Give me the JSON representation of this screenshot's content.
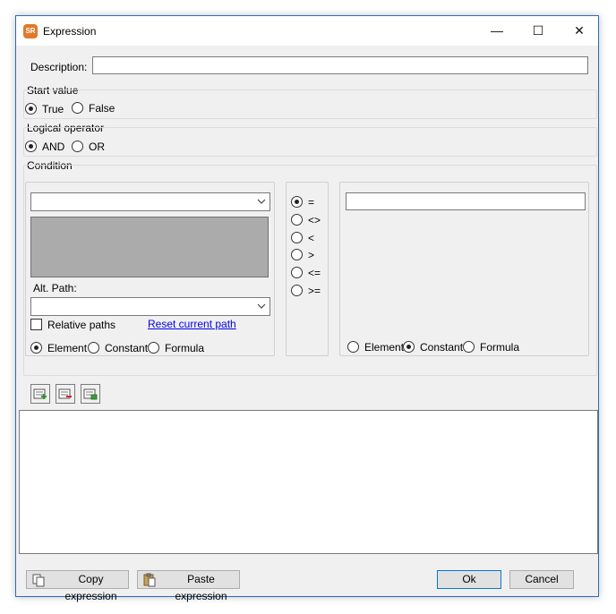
{
  "window": {
    "title": "Expression",
    "icon_text": "SR"
  },
  "titlebar_buttons": {
    "minimize": "—",
    "maximize": "☐",
    "close": "✕"
  },
  "description": {
    "label": "Description:",
    "value": ""
  },
  "start_value": {
    "title": "Start value",
    "options": [
      "True",
      "False"
    ],
    "selected": "True"
  },
  "logical_operator": {
    "title": "Logical operator",
    "options": [
      "AND",
      "OR"
    ],
    "selected": "AND"
  },
  "condition": {
    "title": "Condition",
    "left": {
      "combo_value": "",
      "alt_path_label": "Alt. Path:",
      "alt_path_value": "",
      "relative_paths_label": "Relative paths",
      "relative_paths_checked": false,
      "reset_link": "Reset current path",
      "source_options": [
        "Element",
        "Constant",
        "Formula"
      ],
      "source_selected": "Element"
    },
    "operators": [
      "=",
      "<>",
      "<",
      ">",
      "<=",
      ">="
    ],
    "operator_selected": "=",
    "right": {
      "value": "",
      "source_options": [
        "Element",
        "Constant",
        "Formula"
      ],
      "source_selected": "Constant"
    }
  },
  "toolbar": {
    "items": [
      "add-condition-icon",
      "remove-condition-icon",
      "edit-condition-icon"
    ]
  },
  "expression_text": "",
  "footer": {
    "copy_label": "Copy expression",
    "paste_label": "Paste expression",
    "ok_label": "Ok",
    "cancel_label": "Cancel"
  }
}
